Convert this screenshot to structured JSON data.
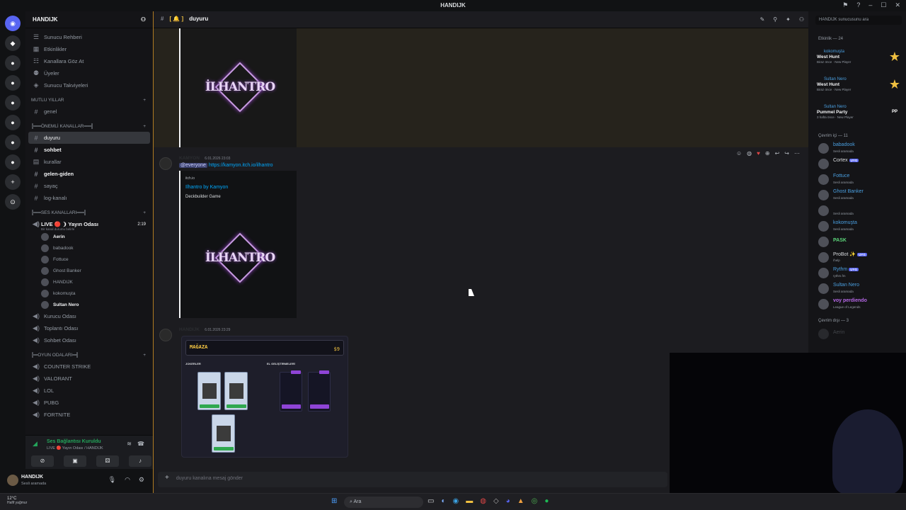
{
  "window": {
    "title": "HANDIJK"
  },
  "server": {
    "name": "HANDIJK",
    "menu": [
      "Sunucu Rehberi",
      "Etkinlikler",
      "Kanallara Göz At",
      "Üyeler",
      "Sunucu Takviyeleri"
    ],
    "category_top": "MUTLU YILLAR",
    "channel_genel": "genel",
    "category_important": "╠══ÖNEMLİ KANALLAR══╣",
    "text_channels": [
      "duyuru",
      "sohbet",
      "kurallar",
      "gelen-giden",
      "sayaç",
      "log-kanalı"
    ],
    "category_voice": "╠══SES KANALLARI══╣",
    "live_channel": "LIVE 🔴 ❩ Yayın Odası",
    "live_time": "2:19",
    "live_status": "Bir kanal durumu belirle",
    "voice_users": [
      "Aerin",
      "babadook",
      "Fottuce",
      "Ghost Banker",
      "HANDIJK",
      "kokomuşta",
      "Sultan Nero"
    ],
    "voice_channels": [
      "Kurucu Odası",
      "Toplantı Odası",
      "Sohbet Odası"
    ],
    "category_games": "╠═OYUN ODALARI═╣",
    "game_channels": [
      "COUNTER STRIKE",
      "VALORANT",
      "LOL",
      "PUBG",
      "FORTNITE"
    ]
  },
  "voice_panel": {
    "status": "Ses Bağlantısı Kuruldu",
    "location": "LIVE 🔴 Yayın Odası / HANDIJK"
  },
  "user_panel": {
    "name": "HANDIJK",
    "status": "Sesli aramada"
  },
  "chat": {
    "channel": "duyuru",
    "logo_text": "İLHANTRO",
    "msg1_author": "KAMYON",
    "msg1_time": "6.01.2026 23:03",
    "msg1_mention": "@everyone",
    "msg1_link": "https://kamyon.itch.io/ilhantro",
    "embed_site": "itch.io",
    "embed_title": "Ilhantro by Kamyon",
    "embed_desc": "Deckbuilder Game",
    "msg2_author": "HANDIJK",
    "msg2_time": "6.01.2026 23:29",
    "shop_title": "MAĞAZA",
    "shop_price": "$9",
    "shop_sec1": "JOKERLER",
    "shop_sec2": "EL GELİŞTİRMELERİ",
    "composer_placeholder": "duyuru kanalına mesaj gönder"
  },
  "members": {
    "search_placeholder": "HANDIJK sunucusunu ara",
    "activity_header": "Etkinlik — 24",
    "activities": [
      {
        "user": "kokomuşta",
        "game": "West Hunt",
        "when": "Biraz önce · New Player"
      },
      {
        "user": "Sultan Nero",
        "game": "West Hunt",
        "when": "Biraz önce · New Player"
      },
      {
        "user": "Sultan Nero",
        "game": "Pummel Party",
        "when": "3 hafta önce · New Player"
      }
    ],
    "online_header": "Çevrim içi — 11",
    "online": [
      {
        "name": "babadook",
        "status": "Sesli aramada"
      },
      {
        "name": "Cortex",
        "status": "",
        "badge": "UYG"
      },
      {
        "name": "Fottuce",
        "status": "Sesli aramada"
      },
      {
        "name": "Ghost Banker",
        "status": "Sesli aramada"
      },
      {
        "name": "",
        "status": "Sesli aramada"
      },
      {
        "name": "kokomuşta",
        "status": "Sesli aramada"
      },
      {
        "name": "PASK",
        "status": ""
      },
      {
        "name": "ProBot ✨",
        "status": "/help",
        "badge": "UYG"
      },
      {
        "name": "Rythm",
        "status": "rythm.fm",
        "badge": "UYG"
      },
      {
        "name": "Sultan Nero",
        "status": "Sesli aramada"
      },
      {
        "name": "voy perdiendo",
        "status": "League of Legends"
      }
    ],
    "offline_header": "Çevrim dışı — 3",
    "offline": [
      "Aerin"
    ]
  },
  "taskbar": {
    "weather_temp": "12°C",
    "weather_desc": "Hafif yağmur",
    "search": "Ara"
  },
  "colors": {
    "accent": "#5865f2",
    "online": "#23a55a",
    "highlight": "#b07b22"
  }
}
